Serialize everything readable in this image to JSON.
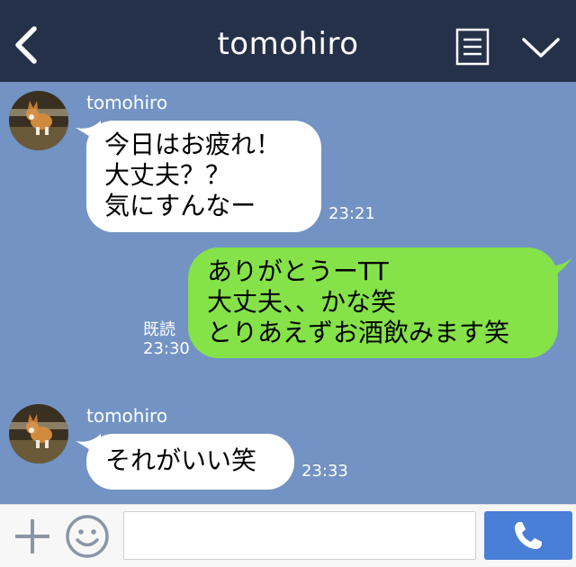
{
  "header": {
    "title": "tomohiro",
    "back_icon": "chevron-left-icon",
    "menu_icon": "list-icon",
    "collapse_icon": "chevron-down-icon"
  },
  "messages": [
    {
      "direction": "incoming",
      "sender": "tomohiro",
      "lines": [
        "今日はお疲れ！",
        "大丈夫？？",
        "気にすんなー"
      ],
      "time": "23:21"
    },
    {
      "direction": "outgoing",
      "lines": [
        "ありがとうーTT",
        "大丈夫、、かな笑",
        "とりあえずお酒飲みます笑"
      ],
      "read_label": "既読",
      "time": "23:30"
    },
    {
      "direction": "incoming",
      "sender": "tomohiro",
      "lines": [
        "それがいい笑"
      ],
      "time": "23:33"
    }
  ],
  "footer": {
    "add_icon": "plus-icon",
    "emoji_icon": "smile-icon",
    "input_value": "",
    "call_icon": "phone-icon"
  },
  "colors": {
    "header_bg": "#253049",
    "chat_bg": "#7293c3",
    "incoming_bubble": "#ffffff",
    "outgoing_bubble": "#85e249",
    "call_button": "#4a7fd8"
  }
}
